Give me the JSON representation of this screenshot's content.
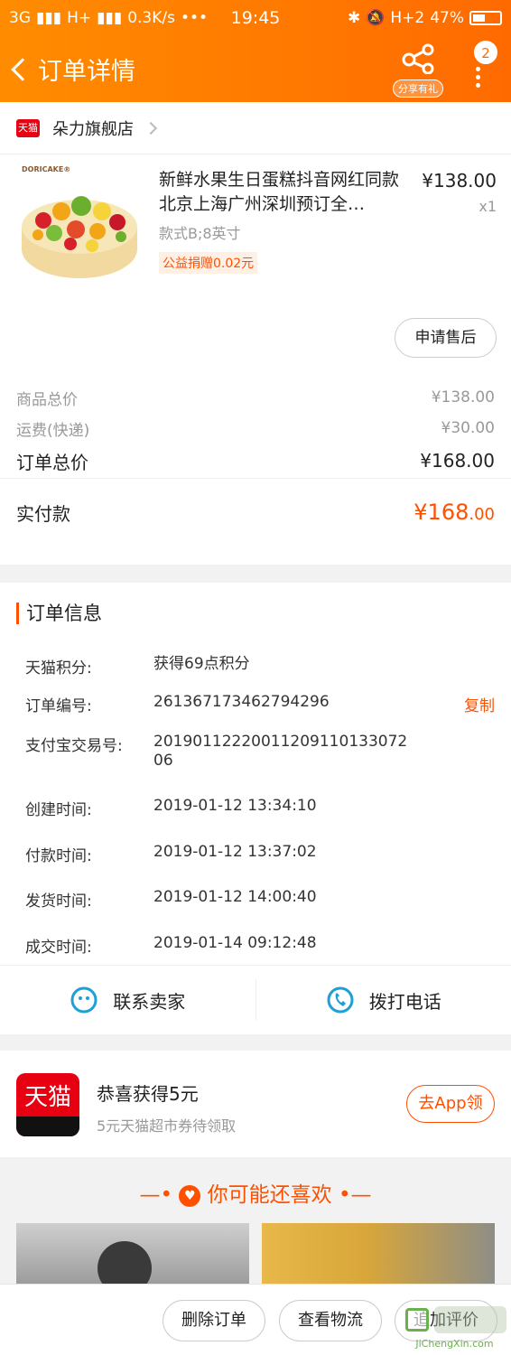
{
  "status": {
    "signal1": "3G",
    "signal2": "H+",
    "speed": "0.3K/s",
    "dots": "•••",
    "time": "19:45",
    "h2": "H+2",
    "battery": "47%",
    "battery_level": 0.47
  },
  "header": {
    "title": "订单详情",
    "share_label": "分享有礼",
    "badge": "2"
  },
  "shop": {
    "logo_text": "天猫",
    "name": "朵力旗舰店"
  },
  "product": {
    "brand": "DORICAKE®",
    "name": "新鲜水果生日蛋糕抖音网红同款北京上海广州深圳预订全…",
    "spec": "款式B;8英寸",
    "donate": "公益捐赠0.02元",
    "price": "¥138.00",
    "qty": "x1",
    "after_sale": "申请售后"
  },
  "summary": {
    "goods_label": "商品总价",
    "goods_val": "¥138.00",
    "ship_label": "运费(快递)",
    "ship_val": "¥30.00",
    "total_label": "订单总价",
    "total_val": "¥168.00",
    "paid_label": "实付款",
    "paid_int": "¥168",
    "paid_dec": ".00"
  },
  "info": {
    "title": "订单信息",
    "copy": "复制",
    "rows": [
      {
        "label": "天猫积分:",
        "value": "获得69点积分"
      },
      {
        "label": "订单编号:",
        "value": "261367173462794296"
      },
      {
        "label": "支付宝交易号:",
        "value": "20190112220011209110133072 06"
      },
      {
        "label": "创建时间:",
        "value": "2019-01-12 13:34:10"
      },
      {
        "label": "付款时间:",
        "value": "2019-01-12 13:37:02"
      },
      {
        "label": "发货时间:",
        "value": "2019-01-12 14:00:40"
      },
      {
        "label": "成交时间:",
        "value": "2019-01-14 09:12:48"
      }
    ]
  },
  "contact": {
    "seller": "联系卖家",
    "phone": "拨打电话"
  },
  "promo": {
    "logo": "天猫",
    "title": "恭喜获得5元",
    "sub": "5元天猫超市券待领取",
    "btn": "去App领"
  },
  "rec": {
    "title": "你可能还喜欢"
  },
  "actions": {
    "delete": "删除订单",
    "logistics": "查看物流",
    "review": "追加评价"
  },
  "watermark": {
    "site": "JiChengXin.com"
  },
  "colors": {
    "accent": "#ff5000",
    "header_start": "#ff8c00",
    "header_end": "#ff6a00",
    "tmall_red": "#e60012",
    "contact_icon": "#1e9fd6"
  }
}
